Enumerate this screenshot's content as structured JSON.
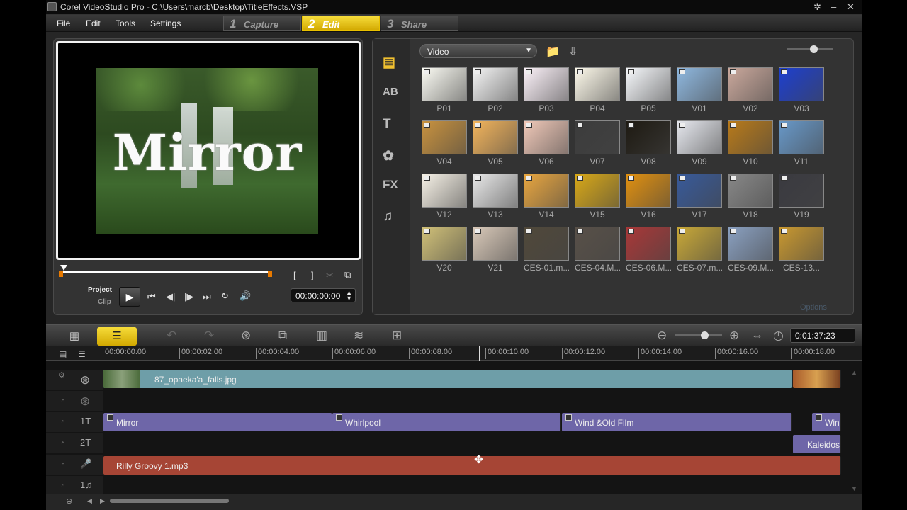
{
  "titlebar": {
    "title": "Corel VideoStudio Pro - C:\\Users\\marcb\\Desktop\\TitleEffects.VSP"
  },
  "menu": [
    "File",
    "Edit",
    "Tools",
    "Settings"
  ],
  "steps": [
    {
      "num": "1",
      "label": "Capture"
    },
    {
      "num": "2",
      "label": "Edit"
    },
    {
      "num": "3",
      "label": "Share"
    }
  ],
  "preview": {
    "overlay_title": "Mirror",
    "mode_project": "Project",
    "mode_clip": "Clip",
    "timecode": "00:00:00:00"
  },
  "library": {
    "category": "Video",
    "options_label": "Options",
    "sidebar_icons": [
      "media-icon",
      "transition-icon",
      "title-icon",
      "graphic-icon",
      "filter-icon",
      "audio-icon"
    ],
    "thumbnails": [
      {
        "label": "P01",
        "color": "#fbfbf3"
      },
      {
        "label": "P02",
        "color": "#f4f4f4"
      },
      {
        "label": "P03",
        "color": "#fbf1f8"
      },
      {
        "label": "P04",
        "color": "#fdf9ea"
      },
      {
        "label": "P05",
        "color": "#f6f8fb"
      },
      {
        "label": "V01",
        "color": "#8fb8df"
      },
      {
        "label": "V02",
        "color": "#caa89c"
      },
      {
        "label": "V03",
        "color": "#1d3fcf"
      },
      {
        "label": "V04",
        "color": "#c8923f"
      },
      {
        "label": "V05",
        "color": "#f2b45c"
      },
      {
        "label": "V06",
        "color": "#f0c8b8"
      },
      {
        "label": "V07",
        "color": "#3c3c3c"
      },
      {
        "label": "V08",
        "color": "#1e1a12"
      },
      {
        "label": "V09",
        "color": "#e6e8ee"
      },
      {
        "label": "V10",
        "color": "#b87a1a"
      },
      {
        "label": "V11",
        "color": "#6898c8"
      },
      {
        "label": "V12",
        "color": "#f6f1e6"
      },
      {
        "label": "V13",
        "color": "#e8e8e8"
      },
      {
        "label": "V14",
        "color": "#e8a640"
      },
      {
        "label": "V15",
        "color": "#d8a818"
      },
      {
        "label": "V16",
        "color": "#e09010"
      },
      {
        "label": "V17",
        "color": "#385a9a"
      },
      {
        "label": "V18",
        "color": "#888888"
      },
      {
        "label": "V19",
        "color": "#3a3a40"
      },
      {
        "label": "V20",
        "color": "#d0c078"
      },
      {
        "label": "V21",
        "color": "#d8c8b8"
      },
      {
        "label": "CES-01.m...",
        "color": "#50483a"
      },
      {
        "label": "CES-04.M...",
        "color": "#585048"
      },
      {
        "label": "CES-06.M...",
        "color": "#a83838"
      },
      {
        "label": "CES-07.m...",
        "color": "#c8a838"
      },
      {
        "label": "CES-09.M...",
        "color": "#8aa0c0"
      },
      {
        "label": "CES-13...",
        "color": "#c89830"
      }
    ]
  },
  "timeline": {
    "duration": "0:01:37:23",
    "ruler": [
      "00:00:00.00",
      "00:00:02.00",
      "00:00:04.00",
      "00:00:06.00",
      "00:00:08.00",
      "00:00:10.00",
      "00:00:12.00",
      "00:00:14.00",
      "00:00:16.00",
      "00:00:18.00"
    ],
    "track_labels": {
      "title1": "1",
      "title2": "2",
      "music1": "1"
    },
    "video_clip": "87_opaeka'a_falls.jpg",
    "title_clips": [
      "Mirror",
      "Whirlpool",
      "Wind &Old Film",
      "Win"
    ],
    "title2_clip": "Kaleidos",
    "audio_clip": "Rilly Groovy 1.mp3"
  }
}
